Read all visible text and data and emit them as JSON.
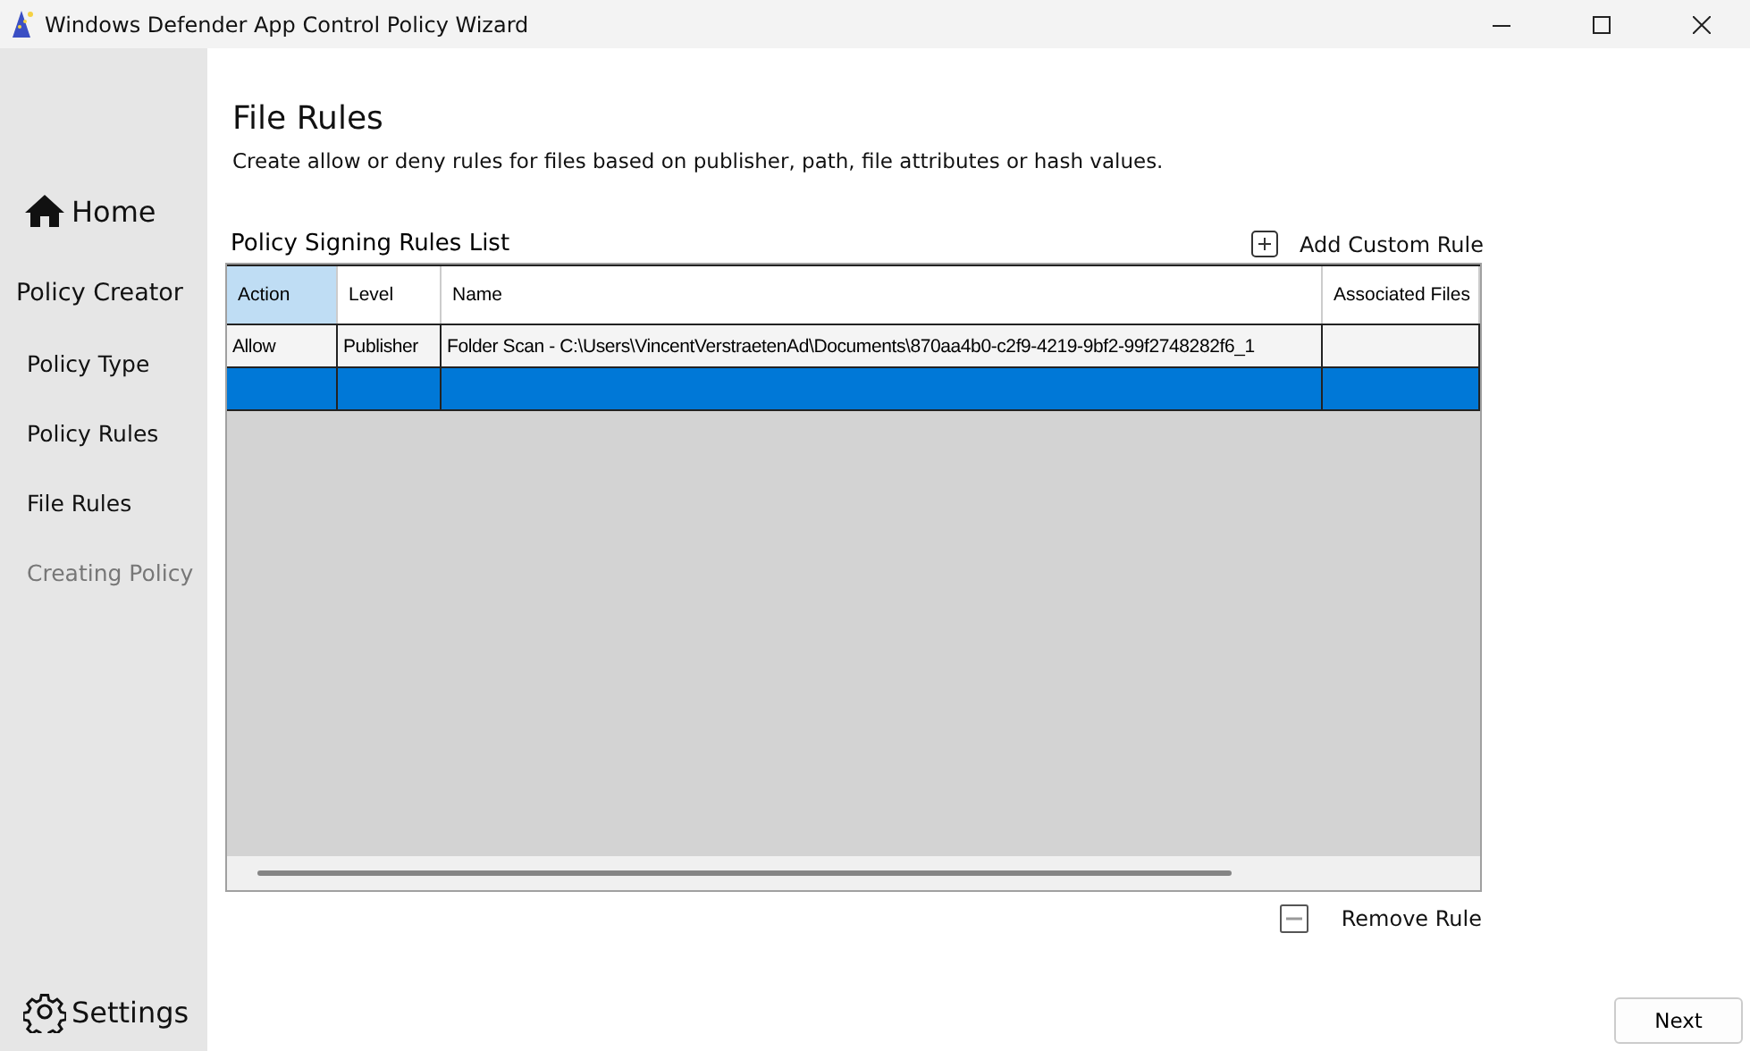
{
  "window": {
    "title": "Windows Defender App Control Policy Wizard"
  },
  "sidebar": {
    "home": "Home",
    "section": "Policy Creator",
    "items": [
      {
        "label": "Policy Type",
        "disabled": false
      },
      {
        "label": "Policy Rules",
        "disabled": false
      },
      {
        "label": "File Rules",
        "disabled": false
      },
      {
        "label": "Creating Policy",
        "disabled": true
      }
    ],
    "settings": "Settings"
  },
  "page": {
    "title": "File Rules",
    "description": "Create allow or deny rules for files based on publisher, path, file attributes or hash values."
  },
  "table": {
    "title": "Policy Signing Rules List",
    "add_button": "Add Custom Rule",
    "remove_button": "Remove Rule",
    "columns": [
      {
        "label": "Action",
        "selected": true
      },
      {
        "label": "Level",
        "selected": false
      },
      {
        "label": "Name",
        "selected": false
      },
      {
        "label": "Associated Files",
        "selected": false
      }
    ],
    "rows": [
      {
        "cells": [
          "Allow",
          "Publisher",
          "Folder Scan - C:\\Users\\VincentVerstraetenAd\\Documents\\870aa4b0-c2f9-4219-9bf2-99f2748282f6_1",
          ""
        ],
        "selected": false
      },
      {
        "cells": [
          "",
          "",
          "",
          ""
        ],
        "selected": true
      }
    ]
  },
  "buttons": {
    "next": "Next"
  }
}
